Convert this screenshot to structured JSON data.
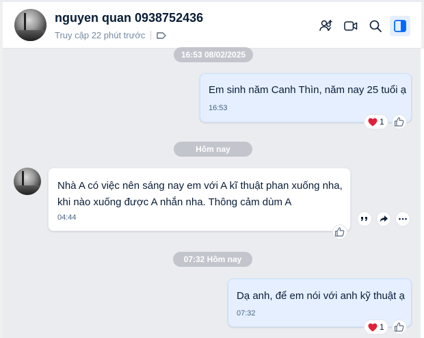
{
  "header": {
    "contact_name": "nguyen quan 0938752436",
    "status": "Truy cập 22 phút trước",
    "icons": [
      "add-friend-icon",
      "video-call-icon",
      "search-icon",
      "conversation-info-icon"
    ],
    "accent": "#0068ff"
  },
  "chat": {
    "date_separator_1": "16:53 08/02/2025",
    "message_1": {
      "text": "Em sinh năm Canh Thìn, năm nay 25 tuổi ạ",
      "time": "16:53",
      "reaction_count": "1"
    },
    "date_separator_2": "Hôm nay",
    "message_2": {
      "line_1": "Nhà A có việc nên sáng nay em với A kĩ thuật phan xuống nha,",
      "line_2": "khi nào xuống được A nhắn nha. Thông cảm dùm A",
      "time": "04:44"
    },
    "date_separator_3": "07:32 Hôm nay",
    "message_3": {
      "text": "Dạ anh, để em nói với anh kỹ thuật ạ",
      "time": "07:32",
      "reaction_count": "1"
    }
  }
}
